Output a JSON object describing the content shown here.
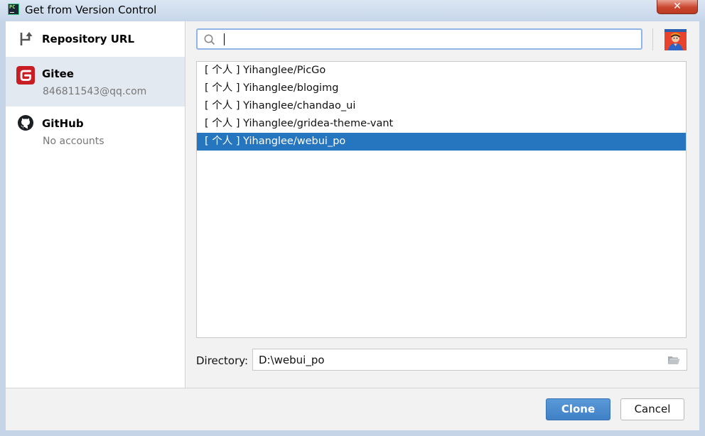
{
  "window": {
    "title": "Get from Version Control",
    "close_symbol": "✕"
  },
  "sidebar": {
    "items": [
      {
        "label": "Repository URL",
        "sub": ""
      },
      {
        "label": "Gitee",
        "sub": "846811543@qq.com"
      },
      {
        "label": "GitHub",
        "sub": "No accounts"
      }
    ],
    "selected_index": 1
  },
  "search": {
    "value": "",
    "placeholder": ""
  },
  "repositories": [
    {
      "label": "[ 个人 ] Yihanglee/PicGo"
    },
    {
      "label": "[ 个人 ] Yihanglee/blogimg"
    },
    {
      "label": "[ 个人 ] Yihanglee/chandao_ui"
    },
    {
      "label": "[ 个人 ] Yihanglee/gridea-theme-vant"
    },
    {
      "label": "[ 个人 ] Yihanglee/webui_po"
    }
  ],
  "selected_repository_index": 4,
  "directory": {
    "label": "Directory:",
    "value": "D:\\webui_po"
  },
  "buttons": {
    "clone": "Clone",
    "cancel": "Cancel"
  },
  "colors": {
    "selection": "#2675bf",
    "gitee": "#c71d23",
    "accent": "#4a8bd0",
    "search_focus": "#8fb6e6"
  },
  "icons": [
    "repository-url-icon",
    "gitee-icon",
    "github-icon",
    "search-icon",
    "folder-icon",
    "avatar",
    "pycharm-icon",
    "close-icon"
  ]
}
